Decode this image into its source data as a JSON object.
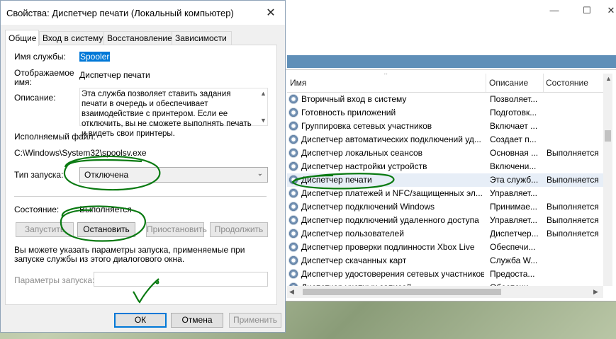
{
  "services_window": {
    "columns": {
      "name": "Имя",
      "description": "Описание",
      "status": "Состояние"
    },
    "rows": [
      {
        "name": "Вторичный вход в систему",
        "description": "Позволяет...",
        "status": ""
      },
      {
        "name": "Готовность приложений",
        "description": "Подготовк...",
        "status": ""
      },
      {
        "name": "Группировка сетевых участников",
        "description": "Включает ...",
        "status": ""
      },
      {
        "name": "Диспетчер автоматических подключений уд...",
        "description": "Создает п...",
        "status": ""
      },
      {
        "name": "Диспетчер локальных сеансов",
        "description": "Основная ...",
        "status": "Выполняется"
      },
      {
        "name": "Диспетчер настройки устройств",
        "description": "Включени...",
        "status": ""
      },
      {
        "name": "Диспетчер печати",
        "description": "Эта служб...",
        "status": "Выполняется"
      },
      {
        "name": "Диспетчер платежей и NFC/защищенных эл...",
        "description": "Управляет...",
        "status": ""
      },
      {
        "name": "Диспетчер подключений Windows",
        "description": "Принимае...",
        "status": "Выполняется"
      },
      {
        "name": "Диспетчер подключений удаленного доступа",
        "description": "Управляет...",
        "status": "Выполняется"
      },
      {
        "name": "Диспетчер пользователей",
        "description": "Диспетчер...",
        "status": "Выполняется"
      },
      {
        "name": "Диспетчер проверки подлинности Xbox Live",
        "description": "Обеспечи...",
        "status": ""
      },
      {
        "name": "Диспетчер скачанных карт",
        "description": "Служба W...",
        "status": ""
      },
      {
        "name": "Диспетчер удостоверения сетевых участников",
        "description": "Предоста...",
        "status": ""
      },
      {
        "name": "Диспетчер учетных записей",
        "description": "Обеспечи...",
        "status": ""
      }
    ]
  },
  "dialog": {
    "title": "Свойства: Диспетчер печати (Локальный компьютер)",
    "tabs": [
      "Общие",
      "Вход в систему",
      "Восстановление",
      "Зависимости"
    ],
    "service_name_label": "Имя службы:",
    "service_name_value": "Spooler",
    "display_name_label": "Отображаемое имя:",
    "display_name_value": "Диспетчер печати",
    "description_label": "Описание:",
    "description_value": "Эта служба позволяет ставить задания печати в очередь и обеспечивает взаимодействие с принтером. Если ее отключить, вы не сможете выполнять печать и видеть свои принтеры.",
    "exe_label": "Исполняемый файл:",
    "exe_path": "C:\\Windows\\System32\\spoolsv.exe",
    "startup_type_label": "Тип запуска:",
    "startup_type_value": "Отключена",
    "status_label": "Состояние:",
    "status_value": "Выполняется",
    "buttons": {
      "start": "Запустить",
      "stop": "Остановить",
      "pause": "Приостановить",
      "resume": "Продолжить"
    },
    "hint_text": "Вы можете указать параметры запуска, применяемые при запуске службы из этого диалогового окна.",
    "params_label": "Параметры запуска:",
    "params_value": "",
    "ok": "ОК",
    "cancel": "Отмена",
    "apply": "Применить"
  },
  "colors": {
    "accent": "#0078d7",
    "annotation_ink": "#0a7a12"
  }
}
